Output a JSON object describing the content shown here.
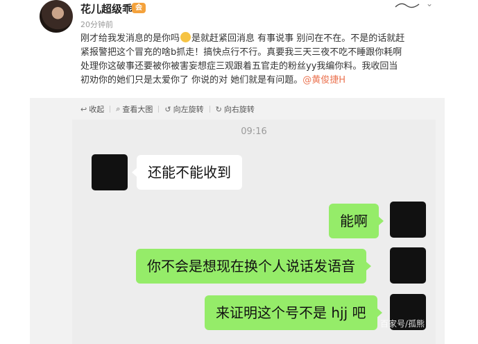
{
  "post": {
    "username": "花儿超级乖",
    "time": "20分钟前",
    "text_1": "刚才给我发消息的是你吗",
    "text_2": "是就赶紧回消息 有事说事 别问在不在。不是的话就赶紧报警把这个冒充的啥b抓走！搞快点行不行。真要我三天三夜不吃不睡跟你耗啊 处理你这破事还要被你被害妄想症三观跟着五官走的粉丝yy我编你料。我收回当初劝你的她们只是太爱你了 你说的对 她们就是有问题。",
    "mention": "@黄俊捷H"
  },
  "toolbar": {
    "collapse": "收起",
    "view_large": "查看大图",
    "rotate_left": "向左旋转",
    "rotate_right": "向右旋转"
  },
  "chat": {
    "time": "09:16",
    "messages": [
      {
        "side": "left",
        "text": "还能不能收到"
      },
      {
        "side": "right",
        "text": "能啊"
      },
      {
        "side": "right",
        "text": "你不会是想现在换个人说话发语音"
      },
      {
        "side": "right",
        "text": "来证明这个号不是 hjj 吧"
      }
    ]
  },
  "watermark": "百家号/孤熊",
  "colors": {
    "mention": "#eb7350",
    "bubble_right": "#95ec69",
    "bubble_left": "#ffffff",
    "chat_bg": "#ededed"
  }
}
